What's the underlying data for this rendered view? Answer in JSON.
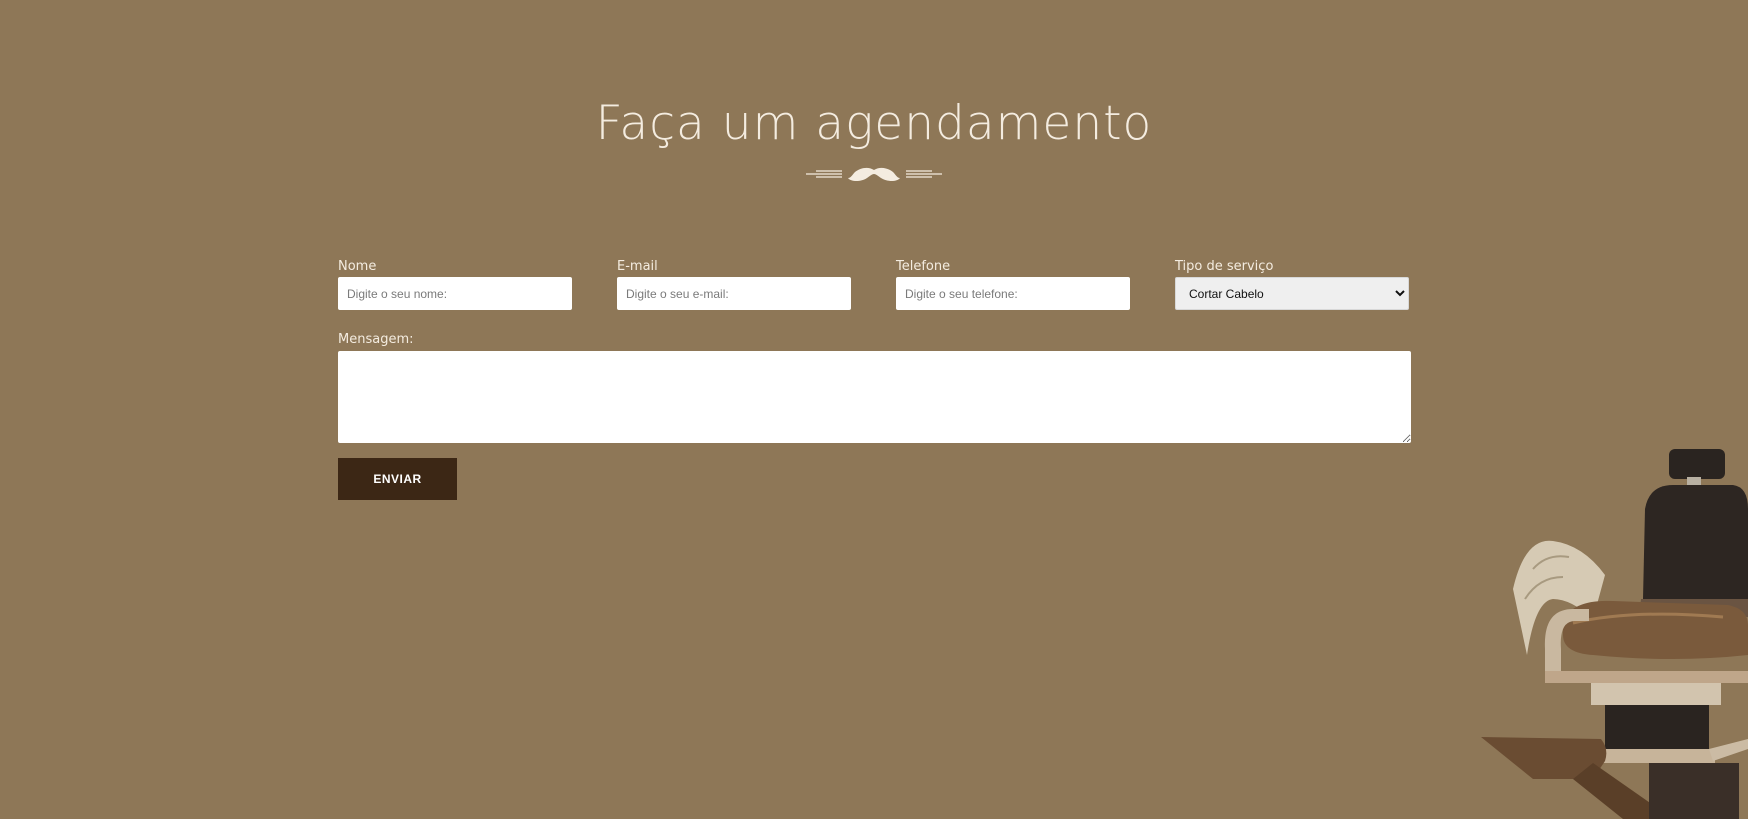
{
  "header": {
    "title": "Faça um agendamento",
    "divider_icon": "mustache-icon"
  },
  "form": {
    "name": {
      "label": "Nome",
      "placeholder": "Digite o seu nome:"
    },
    "email": {
      "label": "E-mail",
      "placeholder": "Digite o seu e-mail:"
    },
    "phone": {
      "label": "Telefone",
      "placeholder": "Digite o seu telefone:"
    },
    "service": {
      "label": "Tipo de serviço",
      "selected": "Cortar Cabelo"
    },
    "message": {
      "label": "Mensagem:"
    },
    "submit_label": "ENVIAR"
  },
  "decoration": {
    "image": "barber-chair"
  },
  "colors": {
    "background": "#8e7757",
    "text_light": "#f4ece0",
    "button": "#3c2715"
  }
}
